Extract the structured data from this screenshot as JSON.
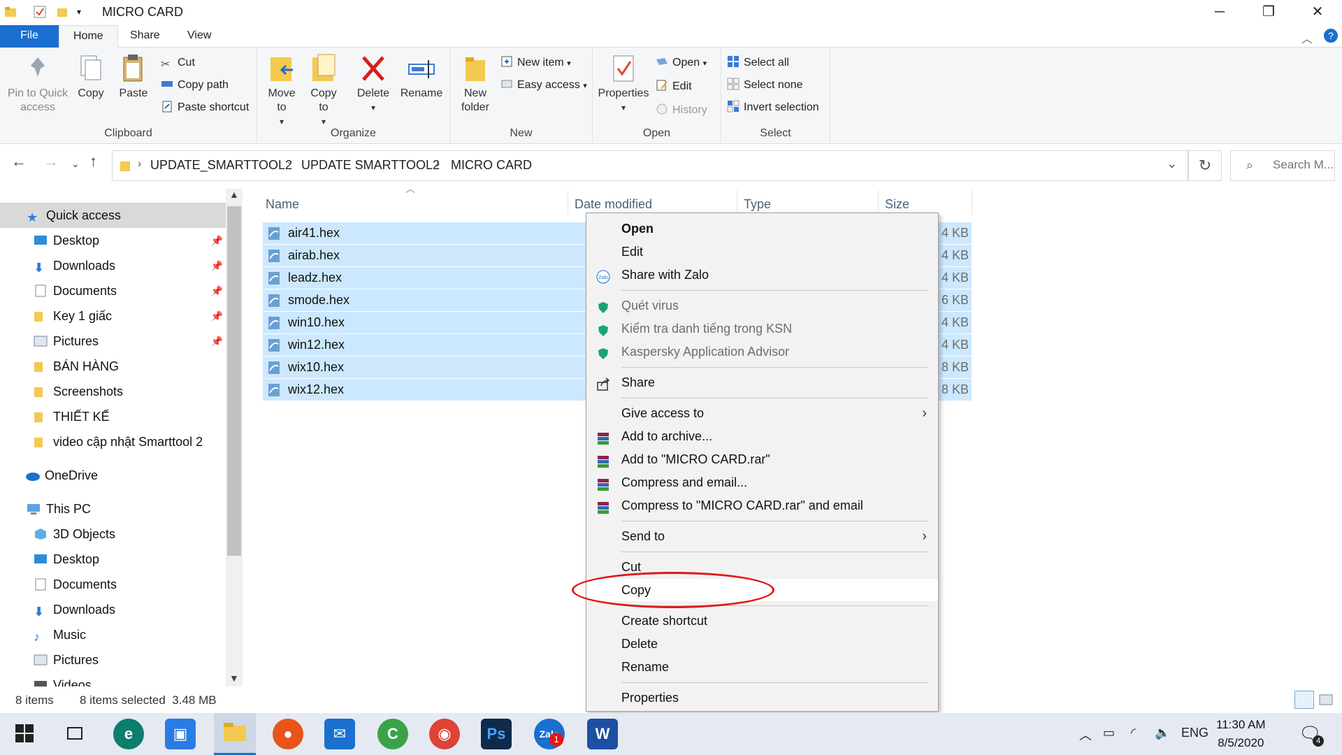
{
  "window": {
    "title": "MICRO CARD",
    "minimize": "─",
    "maximize": "❐",
    "close": "✕"
  },
  "ribbon_tabs": [
    "File",
    "Home",
    "Share",
    "View"
  ],
  "ribbon": {
    "clipboard": {
      "label": "Clipboard",
      "pin": "Pin to Quick access",
      "copy": "Copy",
      "paste": "Paste",
      "cut": "Cut",
      "copy_path": "Copy path",
      "paste_shortcut": "Paste shortcut"
    },
    "organize": {
      "label": "Organize",
      "move_to": "Move to",
      "copy_to": "Copy to",
      "delete": "Delete",
      "rename": "Rename"
    },
    "new": {
      "label": "New",
      "new_folder": "New folder",
      "new_item": "New item",
      "easy_access": "Easy access"
    },
    "open": {
      "label": "Open",
      "properties": "Properties",
      "open": "Open",
      "edit": "Edit",
      "history": "History"
    },
    "select": {
      "label": "Select",
      "select_all": "Select all",
      "select_none": "Select none",
      "invert": "Invert selection"
    }
  },
  "address": {
    "crumbs": [
      "UPDATE_SMARTTOOL2",
      "UPDATE SMARTTOOL2",
      "MICRO CARD"
    ],
    "search_placeholder": "Search M..."
  },
  "nav": {
    "quick_access": "Quick access",
    "pinned": [
      "Desktop",
      "Downloads",
      "Documents",
      "Key 1 giấc",
      "Pictures"
    ],
    "folders": [
      "BÁN HÀNG",
      "Screenshots",
      "THIẾT KẾ",
      "video cập nhật Smarttool 2"
    ],
    "onedrive": "OneDrive",
    "this_pc": "This PC",
    "pc_items": [
      "3D Objects",
      "Desktop",
      "Documents",
      "Downloads",
      "Music",
      "Pictures",
      "Videos"
    ]
  },
  "columns": {
    "name": "Name",
    "date": "Date modified",
    "type": "Type",
    "size": "Size"
  },
  "files": [
    {
      "name": "air41.hex",
      "date": "7/",
      "size": "4 KB"
    },
    {
      "name": "airab.hex",
      "date": "7/",
      "size": "4 KB"
    },
    {
      "name": "leadz.hex",
      "date": "8/",
      "size": "4 KB"
    },
    {
      "name": "smode.hex",
      "date": "7/",
      "size": "6 KB"
    },
    {
      "name": "win10.hex",
      "date": "8/",
      "size": "4 KB"
    },
    {
      "name": "win12.hex",
      "date": "8/",
      "size": "4 KB"
    },
    {
      "name": "wix10.hex",
      "date": "8/",
      "size": "8 KB"
    },
    {
      "name": "wix12.hex",
      "date": "8/",
      "size": "8 KB"
    }
  ],
  "status": {
    "items": "8 items",
    "selected": "8 items selected  3.48 MB"
  },
  "context_menu": {
    "open": "Open",
    "edit": "Edit",
    "share_zalo": "Share with Zalo",
    "scan": "Quét virus",
    "ksn": "Kiểm tra danh tiếng trong KSN",
    "kaspersky": "Kaspersky Application Advisor",
    "share": "Share",
    "give_access": "Give access to",
    "add_archive": "Add to archive...",
    "add_rar": "Add to \"MICRO CARD.rar\"",
    "compress_email": "Compress and email...",
    "compress_rar_email": "Compress to \"MICRO CARD.rar\" and email",
    "send_to": "Send to",
    "cut": "Cut",
    "copy": "Copy",
    "create_shortcut": "Create shortcut",
    "delete": "Delete",
    "rename": "Rename",
    "properties": "Properties"
  },
  "taskbar": {
    "lang": "ENG",
    "time": "11:30 AM",
    "date": "8/5/2020",
    "zalo_badge": "1",
    "notif_count": "4"
  }
}
